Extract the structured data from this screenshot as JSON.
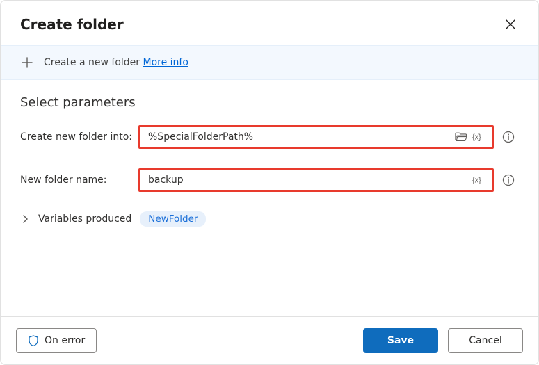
{
  "dialog": {
    "title": "Create folder"
  },
  "banner": {
    "text": "Create a new folder",
    "more_info": "More info"
  },
  "section": {
    "title": "Select parameters"
  },
  "fields": {
    "folder_into_label": "Create new folder into:",
    "folder_into_value": "%SpecialFolderPath%",
    "folder_name_label": "New folder name:",
    "folder_name_value": "backup"
  },
  "variables": {
    "label": "Variables produced",
    "chip": "NewFolder"
  },
  "footer": {
    "on_error": "On error",
    "save": "Save",
    "cancel": "Cancel"
  }
}
